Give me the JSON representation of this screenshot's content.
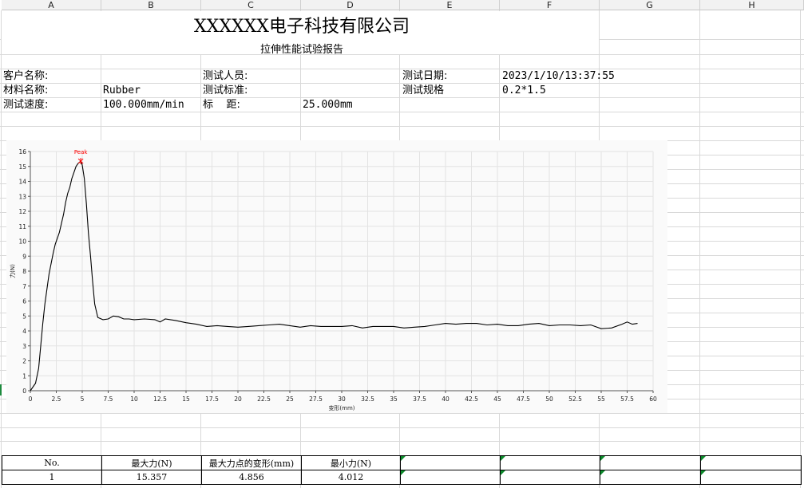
{
  "columns": [
    "A",
    "B",
    "C",
    "D",
    "E",
    "F",
    "G",
    "H"
  ],
  "title": "XXXXXX电子科技有限公司",
  "subtitle": "拉伸性能试验报告",
  "info": {
    "customer_label": "客户名称:",
    "tester_label": "测试人员:",
    "date_label": "测试日期:",
    "date_value": "2023/1/10/13:37:55",
    "material_label": "材料名称:",
    "material_value": "Rubber",
    "standard_label": "测试标准:",
    "spec_label": "测试规格",
    "spec_value": "0.2*1.5",
    "speed_label": "测试速度:",
    "speed_value": "100.000mm/min",
    "gauge_label": "标    距:",
    "gauge_value": "25.000mm"
  },
  "chart_data": {
    "type": "line",
    "xlabel": "变形(mm)",
    "ylabel": "力(N)",
    "xlim": [
      0,
      60
    ],
    "ylim": [
      0,
      16
    ],
    "xticks": [
      "0",
      "2.5",
      "5",
      "7.5",
      "10",
      "12.5",
      "15",
      "17.5",
      "20",
      "22.5",
      "25",
      "27.5",
      "30",
      "32.5",
      "35",
      "37.5",
      "40",
      "42.5",
      "45",
      "47.5",
      "50",
      "52.5",
      "55",
      "57.5",
      "60"
    ],
    "yticks": [
      "0",
      "1",
      "2",
      "3",
      "4",
      "5",
      "6",
      "7",
      "8",
      "9",
      "10",
      "11",
      "12",
      "13",
      "14",
      "15",
      "16"
    ],
    "grid": true,
    "line_color": "#000000",
    "peak": {
      "label": "Peak",
      "x": 4.856,
      "y": 15.357,
      "color": "#ff0000"
    },
    "x": [
      0,
      0.5,
      0.8,
      1.0,
      1.2,
      1.4,
      1.6,
      1.8,
      2.0,
      2.2,
      2.4,
      2.6,
      2.8,
      3.0,
      3.2,
      3.4,
      3.6,
      3.8,
      4.0,
      4.2,
      4.4,
      4.6,
      4.856,
      5.0,
      5.2,
      5.4,
      5.6,
      5.8,
      6.0,
      6.2,
      6.5,
      7.0,
      7.5,
      8.0,
      8.5,
      9.0,
      9.5,
      10,
      11,
      12,
      12.5,
      13,
      14,
      15,
      16,
      17,
      18,
      19,
      20,
      21,
      22,
      23,
      24,
      25,
      26,
      27,
      28,
      29,
      30,
      31,
      32,
      33,
      34,
      35,
      36,
      37,
      38,
      39,
      40,
      41,
      42,
      43,
      44,
      45,
      46,
      47,
      48,
      49,
      50,
      51,
      52,
      53,
      54,
      55,
      56,
      57,
      57.5,
      58,
      58.5
    ],
    "y": [
      0,
      0.5,
      1.5,
      3,
      4.5,
      5.8,
      6.8,
      7.8,
      8.5,
      9.2,
      9.8,
      10.2,
      10.6,
      11.2,
      11.8,
      12.6,
      13.2,
      13.6,
      14.2,
      14.6,
      15.0,
      15.2,
      15.357,
      15.1,
      14.2,
      12.5,
      10.5,
      9.0,
      7.3,
      5.8,
      4.9,
      4.75,
      4.8,
      5.0,
      4.95,
      4.8,
      4.8,
      4.75,
      4.8,
      4.75,
      4.6,
      4.8,
      4.7,
      4.55,
      4.45,
      4.3,
      4.35,
      4.3,
      4.25,
      4.3,
      4.35,
      4.4,
      4.45,
      4.35,
      4.25,
      4.35,
      4.3,
      4.3,
      4.3,
      4.35,
      4.2,
      4.3,
      4.3,
      4.3,
      4.2,
      4.25,
      4.3,
      4.4,
      4.5,
      4.45,
      4.5,
      4.5,
      4.4,
      4.45,
      4.35,
      4.35,
      4.45,
      4.5,
      4.35,
      4.4,
      4.4,
      4.35,
      4.4,
      4.15,
      4.2,
      4.45,
      4.6,
      4.45,
      4.5
    ]
  },
  "table": {
    "headers": [
      "No.",
      "最大力(N)",
      "最大力点的变形(mm)",
      "最小力(N)"
    ],
    "row": [
      "1",
      "15.357",
      "4.856",
      "4.012"
    ]
  }
}
